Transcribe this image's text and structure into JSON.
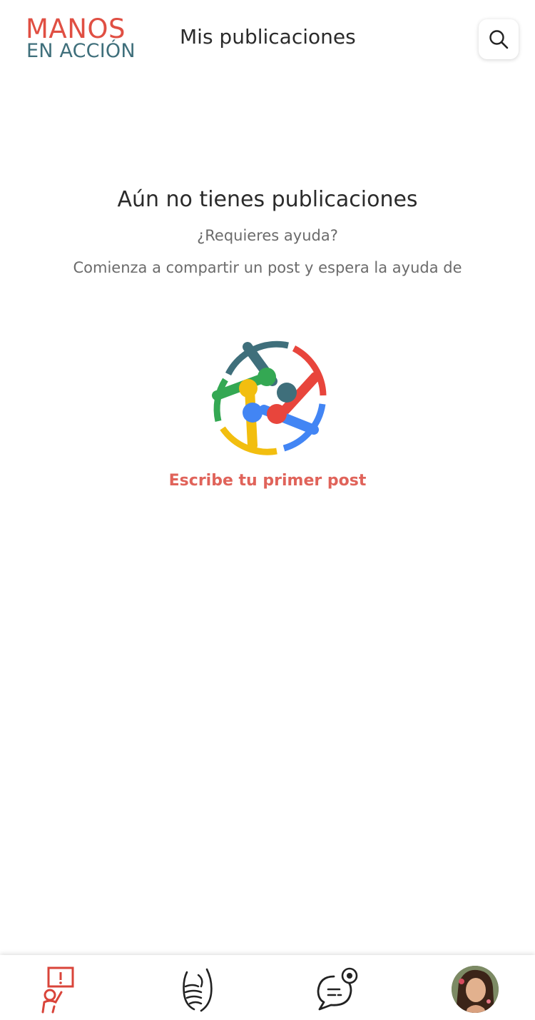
{
  "header": {
    "logo_line1": "MANOS",
    "logo_line2": "EN ACCIÓN",
    "title": "Mis publicaciones",
    "search_icon": "search-icon"
  },
  "empty_state": {
    "title": "Aún no tienes publicaciones",
    "question": "¿Requieres ayuda?",
    "description": "Comienza a compartir un post y espera la ayuda de",
    "illustration": "joined-hands-circle-illustration",
    "cta": "Escribe tu primer post"
  },
  "bottom_nav": {
    "items": [
      {
        "name": "requests",
        "icon": "person-alert-sign-icon"
      },
      {
        "name": "help",
        "icon": "handshake-icon"
      },
      {
        "name": "messages",
        "icon": "chat-eye-icon"
      },
      {
        "name": "profile",
        "icon": "avatar"
      }
    ]
  },
  "colors": {
    "brand_red": "#e04f43",
    "brand_teal": "#3f6f7b",
    "cta": "#e0635a",
    "green": "#34a853",
    "yellow": "#f2be0f",
    "blue": "#4285f4"
  }
}
